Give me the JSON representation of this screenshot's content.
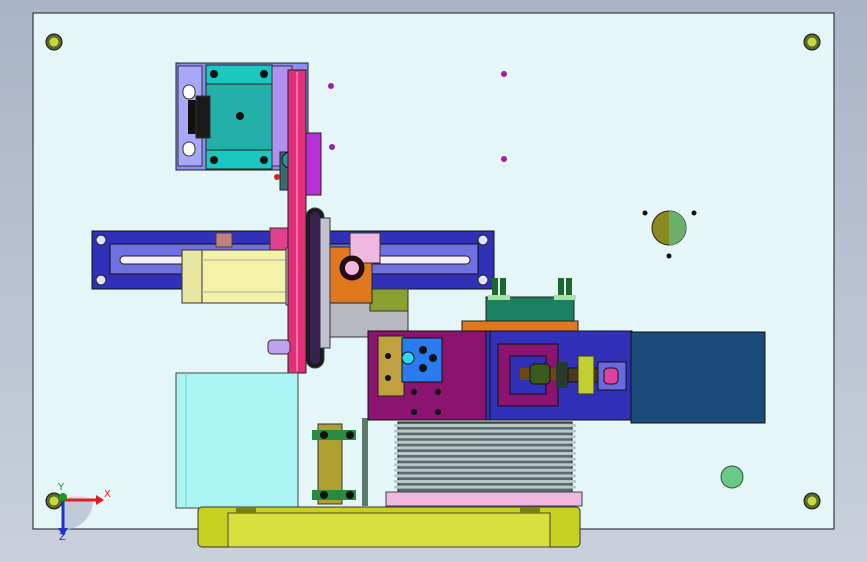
{
  "viewport": {
    "background_top": "#a9b4c6",
    "background_bottom": "#c9d0dc",
    "plate_color": "#e4f6f8"
  },
  "triad": {
    "x_label": "X",
    "y_label": "Y",
    "z_label": "Z",
    "x_color": "#e02020",
    "y_color": "#1a9a1a",
    "z_color": "#2030c8"
  },
  "palette": {
    "magenta": "#e0307a",
    "purple": "#8a1470",
    "blue": "#3030b8",
    "navy": "#1a4a78",
    "cyan": "#20c8c0",
    "lavender": "#8c8cf0",
    "olive": "#c8d020",
    "pink": "#f0b8e0",
    "cream": "#f4f2a8",
    "orange": "#e07820"
  },
  "components": [
    "base-plate",
    "bearing-block",
    "timing-belt",
    "horizontal-slide-rail",
    "servo-motor",
    "pulley-assembly",
    "camera-bracket",
    "gripper-head",
    "linear-actuator",
    "actuator-motor",
    "bellows",
    "bottom-base",
    "cylinder-box",
    "side-bracket",
    "round-hole",
    "mounting-holes"
  ]
}
